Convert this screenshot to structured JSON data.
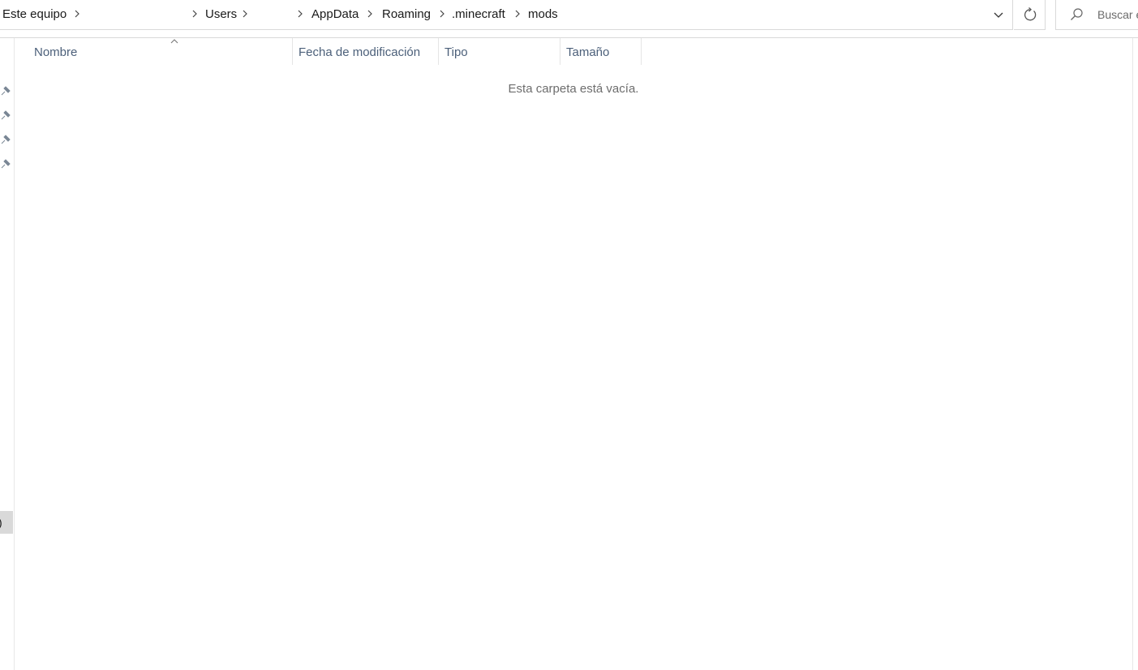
{
  "breadcrumb": {
    "items": [
      {
        "label": "Este equipo"
      },
      {
        "label": "Users"
      },
      {
        "label": "AppData"
      },
      {
        "label": "Roaming"
      },
      {
        "label": ".minecraft"
      },
      {
        "label": "mods"
      }
    ]
  },
  "search": {
    "placeholder": "Buscar e"
  },
  "columns": [
    {
      "label": "Nombre",
      "sorted": "ascending"
    },
    {
      "label": "Fecha de modificación"
    },
    {
      "label": "Tipo"
    },
    {
      "label": "Tamaño"
    }
  ],
  "content": {
    "empty_message": "Esta carpeta está vacía."
  },
  "nav": {
    "pinned_count": 4,
    "selected_fragment": ")"
  },
  "icons": {
    "separator": "chevron-right-icon",
    "dropdown": "chevron-down-icon",
    "refresh": "refresh-icon",
    "search": "search-icon",
    "pin": "pin-icon"
  },
  "colors": {
    "header_text": "#4c607a",
    "empty_text": "#6d6d6d",
    "selected_nav_bg": "#d9d9d9"
  }
}
